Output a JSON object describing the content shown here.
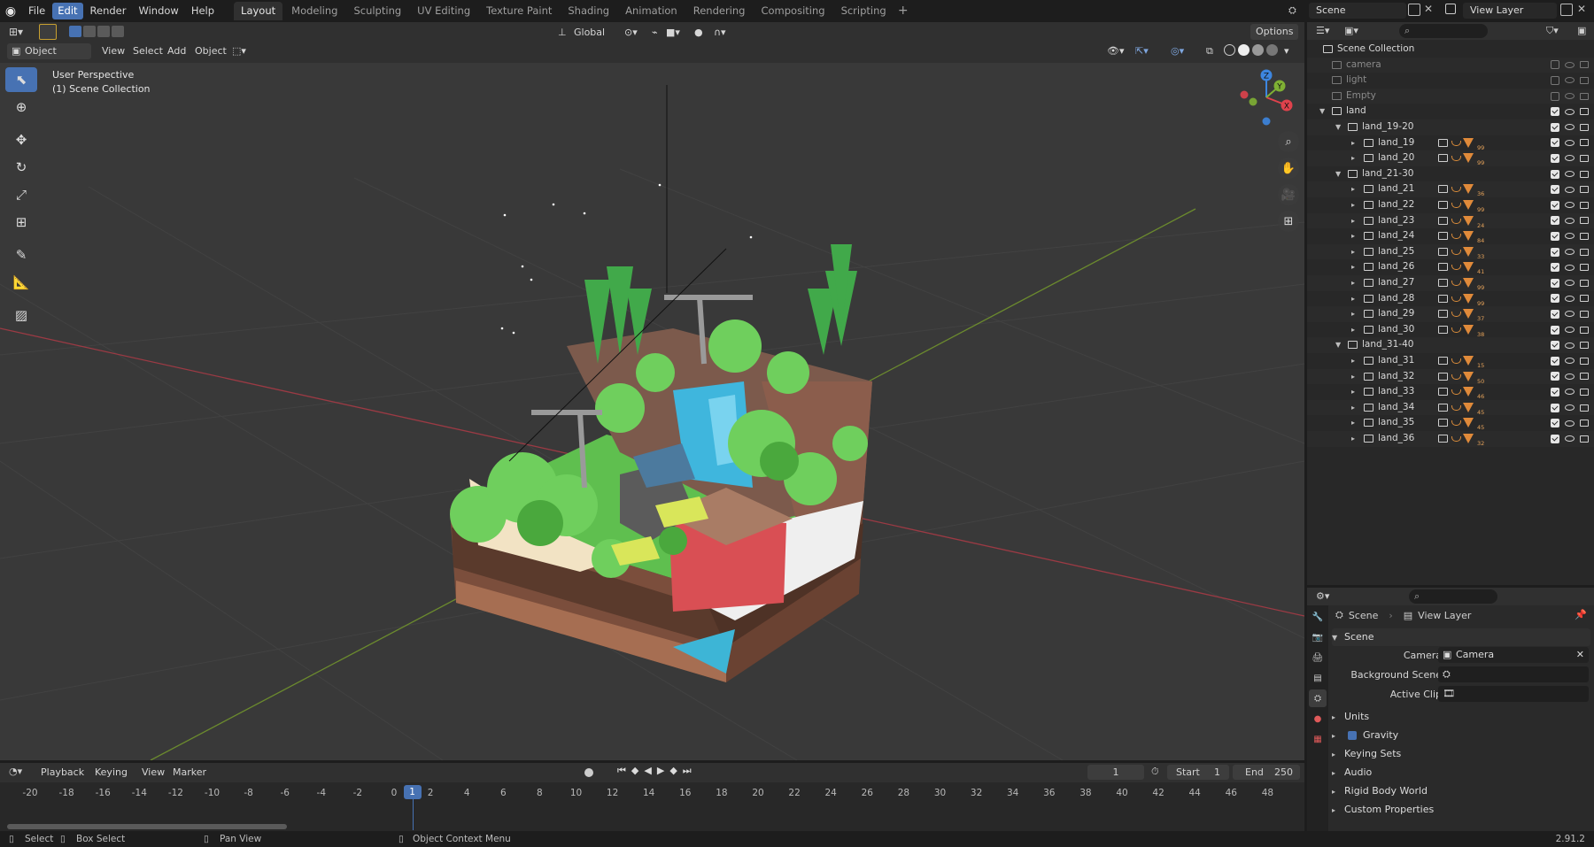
{
  "app": {
    "menu": [
      "File",
      "Edit",
      "Render",
      "Window",
      "Help"
    ],
    "active_menu": "Edit",
    "workspaces": [
      "Layout",
      "Modeling",
      "Sculpting",
      "UV Editing",
      "Texture Paint",
      "Shading",
      "Animation",
      "Rendering",
      "Compositing",
      "Scripting"
    ],
    "active_workspace": "Layout",
    "scene_name": "Scene",
    "view_layer_name": "View Layer"
  },
  "viewport_header": {
    "mode": "Object Mode",
    "menus": [
      "View",
      "Select",
      "Add",
      "Object"
    ],
    "transform_orientation": "Global",
    "options": "Options"
  },
  "viewport": {
    "perspective_label": "User Perspective",
    "collection_label": "(1) Scene Collection",
    "gizmo_axes": [
      "X",
      "Y",
      "Z"
    ]
  },
  "outliner": {
    "rows": [
      {
        "label": "Scene Collection",
        "depth": 0,
        "expand": "",
        "dim": false,
        "badges": []
      },
      {
        "label": "camera",
        "depth": 1,
        "expand": "",
        "dim": true,
        "badges": []
      },
      {
        "label": "light",
        "depth": 1,
        "expand": "",
        "dim": true,
        "badges": []
      },
      {
        "label": "Empty",
        "depth": 1,
        "expand": "",
        "dim": true,
        "badges": []
      },
      {
        "label": "land",
        "depth": 1,
        "expand": "▼",
        "dim": false,
        "badges": []
      },
      {
        "label": "land_19-20",
        "depth": 2,
        "expand": "▼",
        "dim": false,
        "badges": []
      },
      {
        "label": "land_19",
        "depth": 3,
        "expand": "▸",
        "dim": false,
        "badges": [
          "99"
        ]
      },
      {
        "label": "land_20",
        "depth": 3,
        "expand": "▸",
        "dim": false,
        "badges": [
          "99"
        ]
      },
      {
        "label": "land_21-30",
        "depth": 2,
        "expand": "▼",
        "dim": false,
        "badges": []
      },
      {
        "label": "land_21",
        "depth": 3,
        "expand": "▸",
        "dim": false,
        "badges": [
          "36"
        ]
      },
      {
        "label": "land_22",
        "depth": 3,
        "expand": "▸",
        "dim": false,
        "badges": [
          "99"
        ]
      },
      {
        "label": "land_23",
        "depth": 3,
        "expand": "▸",
        "dim": false,
        "badges": [
          "24"
        ]
      },
      {
        "label": "land_24",
        "depth": 3,
        "expand": "▸",
        "dim": false,
        "badges": [
          "84"
        ]
      },
      {
        "label": "land_25",
        "depth": 3,
        "expand": "▸",
        "dim": false,
        "badges": [
          "33"
        ]
      },
      {
        "label": "land_26",
        "depth": 3,
        "expand": "▸",
        "dim": false,
        "badges": [
          "41"
        ]
      },
      {
        "label": "land_27",
        "depth": 3,
        "expand": "▸",
        "dim": false,
        "badges": [
          "99"
        ]
      },
      {
        "label": "land_28",
        "depth": 3,
        "expand": "▸",
        "dim": false,
        "badges": [
          "99"
        ]
      },
      {
        "label": "land_29",
        "depth": 3,
        "expand": "▸",
        "dim": false,
        "badges": [
          "37"
        ]
      },
      {
        "label": "land_30",
        "depth": 3,
        "expand": "▸",
        "dim": false,
        "badges": [
          "38"
        ]
      },
      {
        "label": "land_31-40",
        "depth": 2,
        "expand": "▼",
        "dim": false,
        "badges": []
      },
      {
        "label": "land_31",
        "depth": 3,
        "expand": "▸",
        "dim": false,
        "badges": [
          "15"
        ]
      },
      {
        "label": "land_32",
        "depth": 3,
        "expand": "▸",
        "dim": false,
        "badges": [
          "50"
        ]
      },
      {
        "label": "land_33",
        "depth": 3,
        "expand": "▸",
        "dim": false,
        "badges": [
          "46"
        ]
      },
      {
        "label": "land_34",
        "depth": 3,
        "expand": "▸",
        "dim": false,
        "badges": [
          "45"
        ]
      },
      {
        "label": "land_35",
        "depth": 3,
        "expand": "▸",
        "dim": false,
        "badges": [
          "45"
        ]
      },
      {
        "label": "land_36",
        "depth": 3,
        "expand": "▸",
        "dim": false,
        "badges": [
          "32"
        ]
      }
    ]
  },
  "properties": {
    "breadcrumb": [
      "Scene",
      "View Layer"
    ],
    "panel_title": "Scene",
    "fields": [
      {
        "label": "Camera",
        "value": "Camera"
      },
      {
        "label": "Background Scene",
        "value": ""
      },
      {
        "label": "Active Clip",
        "value": ""
      }
    ],
    "subpanels": [
      "Units",
      "Gravity",
      "Keying Sets",
      "Audio",
      "Rigid Body World",
      "Custom Properties"
    ],
    "gravity_enabled": true
  },
  "timeline": {
    "menus": [
      "Playback",
      "Keying",
      "View",
      "Marker"
    ],
    "current_frame": "1",
    "start_label": "Start",
    "start_value": "1",
    "end_label": "End",
    "end_value": "250",
    "ticks": [
      "-20",
      "-18",
      "-16",
      "-14",
      "-12",
      "-10",
      "-8",
      "-6",
      "-4",
      "-2",
      "0",
      "2",
      "4",
      "6",
      "8",
      "10",
      "12",
      "14",
      "16",
      "18",
      "20",
      "22",
      "24",
      "26",
      "28",
      "30",
      "32",
      "34",
      "36",
      "38",
      "40",
      "42",
      "44",
      "46",
      "48"
    ],
    "playhead": "1"
  },
  "statusbar": {
    "select": "Select",
    "box_select": "Box Select",
    "pan_view": "Pan View",
    "context_menu": "Object Context Menu",
    "version": "2.91.2"
  },
  "colors": {
    "accent": "#4772b3",
    "x_axis": "#e0424c",
    "y_axis": "#7fb034",
    "z_axis": "#3d86e0"
  }
}
